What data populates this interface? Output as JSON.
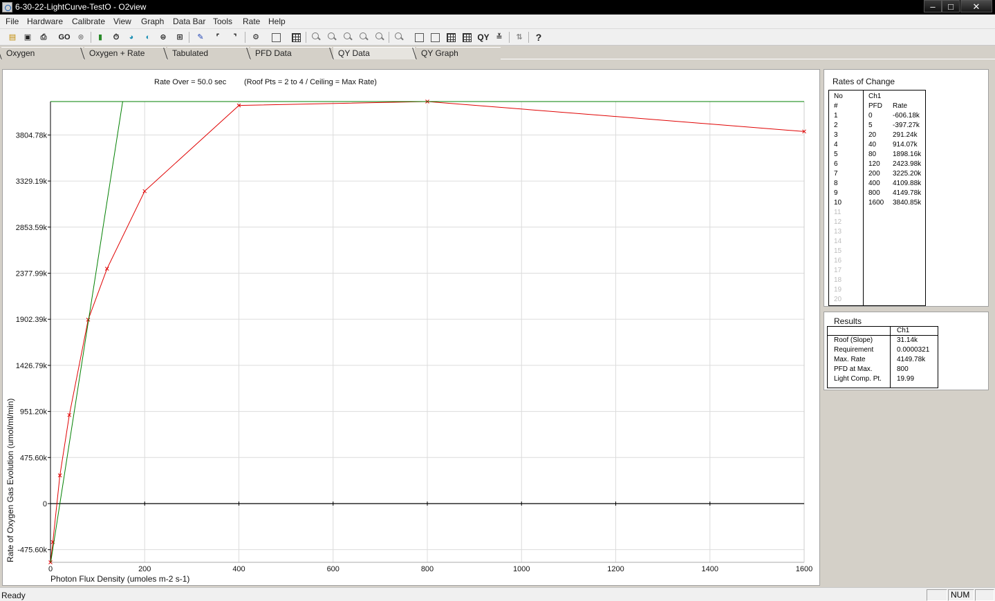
{
  "window": {
    "title": "6-30-22-LightCurve-TestO - O2view",
    "min": "–",
    "max": "□",
    "close": "✕"
  },
  "menu": [
    "File",
    "Hardware",
    "Calibrate",
    "View",
    "Graph",
    "Data Bar",
    "Tools",
    "Rate",
    "Help"
  ],
  "toolbar": {
    "go_label": "GO",
    "qy_label": "QY",
    "help_label": "?"
  },
  "tabs": [
    "Oxygen",
    "Oxygen + Rate",
    "Tabulated",
    "PFD Data",
    "QY Data",
    "QY Graph"
  ],
  "active_tab": "QY Data",
  "chart_header": {
    "rate_over": "Rate Over = 50.0 sec",
    "roof_info": "(Roof Pts = 2 to 4 / Ceiling = Max Rate)"
  },
  "chart_data": {
    "type": "line",
    "xlabel": "Photon Flux Density (umoles m-2 s-1)",
    "ylabel": "Rate of Oxygen Gas Evolution (umol/ml/min)",
    "xlim": [
      0,
      1600
    ],
    "x_ticks": [
      0,
      200,
      400,
      600,
      800,
      1000,
      1200,
      1400,
      1600
    ],
    "x_tick_labels": [
      "0",
      "200",
      "400",
      "600",
      "800",
      "1000",
      "1200",
      "1400",
      "1600"
    ],
    "y_ticks": [
      -475.6,
      0,
      475.6,
      951.2,
      1426.79,
      1902.39,
      2377.99,
      2853.59,
      3329.19,
      3804.78
    ],
    "y_tick_labels": [
      "-475.60k",
      "0",
      "475.60k",
      "951.20k",
      "1426.79k",
      "1902.39k",
      "2377.99k",
      "2853.59k",
      "3329.19k",
      "3804.78k"
    ],
    "ylim": [
      -606.18,
      4149.78
    ],
    "grid": true,
    "series": [
      {
        "color": "#e00000",
        "marker": "x",
        "x": [
          0,
          5,
          20,
          40,
          80,
          120,
          200,
          400,
          800,
          1600
        ],
        "y": [
          -606.18,
          -397.27,
          291.24,
          914.07,
          1898.16,
          2423.98,
          3225.2,
          4109.88,
          4149.78,
          3840.85
        ]
      },
      {
        "color": "#008000",
        "kind": "slope_line",
        "slope": 31.14,
        "intercept": -622.4
      },
      {
        "color": "#008000",
        "kind": "ceiling",
        "y": 4149.78
      }
    ]
  },
  "rates_of_change": {
    "title": "Rates of Change",
    "header_no": "No",
    "header_hash": "#",
    "header_ch": "Ch1",
    "header_pfd": "PFD",
    "header_rate": "Rate",
    "rows": [
      {
        "no": "1",
        "pfd": "0",
        "rate": "-606.18k"
      },
      {
        "no": "2",
        "pfd": "5",
        "rate": "-397.27k"
      },
      {
        "no": "3",
        "pfd": "20",
        "rate": "291.24k"
      },
      {
        "no": "4",
        "pfd": "40",
        "rate": "914.07k"
      },
      {
        "no": "5",
        "pfd": "80",
        "rate": "1898.16k"
      },
      {
        "no": "6",
        "pfd": "120",
        "rate": "2423.98k"
      },
      {
        "no": "7",
        "pfd": "200",
        "rate": "3225.20k"
      },
      {
        "no": "8",
        "pfd": "400",
        "rate": "4109.88k"
      },
      {
        "no": "9",
        "pfd": "800",
        "rate": "4149.78k"
      },
      {
        "no": "10",
        "pfd": "1600",
        "rate": "3840.85k"
      },
      {
        "no": "11",
        "pfd": "",
        "rate": ""
      },
      {
        "no": "12",
        "pfd": "",
        "rate": ""
      },
      {
        "no": "13",
        "pfd": "",
        "rate": ""
      },
      {
        "no": "14",
        "pfd": "",
        "rate": ""
      },
      {
        "no": "15",
        "pfd": "",
        "rate": ""
      },
      {
        "no": "16",
        "pfd": "",
        "rate": ""
      },
      {
        "no": "17",
        "pfd": "",
        "rate": ""
      },
      {
        "no": "18",
        "pfd": "",
        "rate": ""
      },
      {
        "no": "19",
        "pfd": "",
        "rate": ""
      },
      {
        "no": "20",
        "pfd": "",
        "rate": ""
      }
    ]
  },
  "results": {
    "title": "Results",
    "header_ch": "Ch1",
    "rows": [
      {
        "label": "Roof (Slope)",
        "value": "31.14k"
      },
      {
        "label": "Requirement",
        "value": "0.0000321"
      },
      {
        "label": "Max. Rate",
        "value": "4149.78k"
      },
      {
        "label": "PFD at Max.",
        "value": "800"
      },
      {
        "label": "Light Comp. Pt.",
        "value": "19.99"
      }
    ]
  },
  "status": {
    "text": "Ready",
    "num": "NUM"
  }
}
